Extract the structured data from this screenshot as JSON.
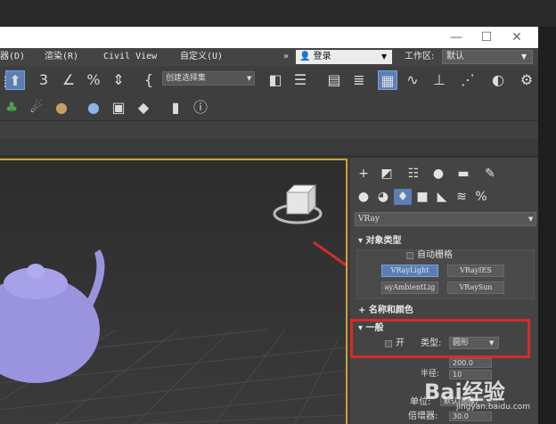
{
  "window": {
    "minimize": "—",
    "maximize": "☐",
    "close": "✕"
  },
  "menubar": {
    "items": [
      "器(D)",
      "渲染(R)",
      "Civil View",
      "自定义(U)"
    ],
    "expand": "»",
    "login": "登录",
    "workspace_label": "工作区:",
    "workspace_value": "默认"
  },
  "toolbar": {
    "selection_set": "创建选择集",
    "snap_label": "3",
    "percent_label": "%"
  },
  "command_panel": {
    "renderer_dropdown": "VRay",
    "object_type": {
      "header": "对象类型",
      "auto_grid": "自动栅格",
      "buttons": [
        "VRayLight",
        "VRayIES",
        "ayAmbientLig",
        "VRaySun"
      ]
    },
    "name_color": {
      "header": "名称和颜色"
    },
    "general": {
      "header": "一般",
      "on_label": "开",
      "type_label": "类型:",
      "type_value": "圆形",
      "radius_label": "半径:",
      "radius_value": "10",
      "target_value": "200.0",
      "units_label": "单位:",
      "units_value": "默认(图像)",
      "multiplier_label": "倍增器:",
      "multiplier_value": "30.0"
    }
  },
  "watermark": {
    "brand": "Bai经验",
    "url": "jingyan.baidu.com"
  },
  "colors": {
    "accent": "#5b7fb5",
    "highlight_box": "#d52b2b",
    "viewport_border": "#c8a23a",
    "teapot": "#9a94df"
  }
}
